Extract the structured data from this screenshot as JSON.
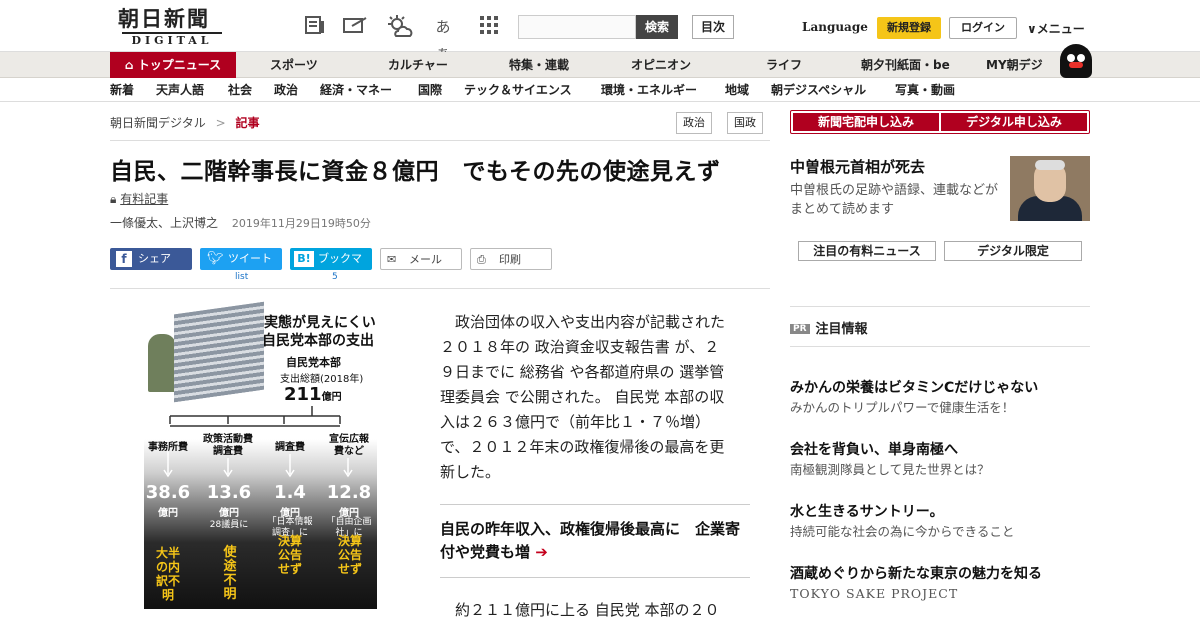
{
  "header": {
    "logo_jp": "朝日新聞",
    "logo_en": "DIGITAL",
    "search_button": "検索",
    "search_placeholder": "",
    "index_button": "目次",
    "language": "Language",
    "register": "新規登録",
    "login": "ログイン",
    "menu": "∨メニュー",
    "font_size_icon_text": "あぁ"
  },
  "nav_main": {
    "home": "トップニュース",
    "items": [
      "スポーツ",
      "カルチャー",
      "特集・連載",
      "オピニオン",
      "ライフ",
      "朝夕刊紙面・be",
      "MY朝デジ"
    ]
  },
  "nav_sub": {
    "items": [
      "新着",
      "天声人語",
      "社会",
      "政治",
      "経済・マネー",
      "国際",
      "テック＆サイエンス",
      "環境・エネルギー",
      "地域",
      "朝デジスペシャル",
      "写真・動画"
    ]
  },
  "breadcrumb": {
    "root": "朝日新聞デジタル",
    "sep": ">",
    "current": "記事"
  },
  "tags": [
    "政治",
    "国政"
  ],
  "article": {
    "title": "自民、二階幹事長に資金８億円　でもその先の使途見えず",
    "paid_label": "有料記事",
    "authors": "一條優太、上沢博之",
    "date": "2019年11月29日19時50分",
    "share": {
      "facebook": "シェア",
      "twitter": "ツイート",
      "hatena": "ブックマーク",
      "mail": "メール",
      "print": "印刷",
      "twitter_sub": "list",
      "hatena_sub": "5"
    },
    "para1_lines": [
      "　政治団体の収入や支出内容が記載された",
      "２０１８年の 政治資金収支報告書 が、２",
      "９日までに 総務省 や各都道府県の 選挙管",
      "理委員会 で公開された。 自民党 本部の収",
      "入は２６３億円で（前年比１・７％増）",
      "で、２０１２年末の政権復帰後の最高を更",
      "新した。"
    ],
    "related": "自民の昨年収入、政権復帰後最高に　企業寄付や党費も増",
    "para2_line": "　約２１１億円に上る 自民党 本部の２０"
  },
  "figure": {
    "heading1": "実態が見えにくい",
    "heading2": "自民党本部の支出",
    "sub1": "自民党本部",
    "sub2": "支出総額(2018年)",
    "total": "211",
    "total_unit": "億円",
    "categories": [
      {
        "label": "事務所費",
        "value": "38.6",
        "unit": "億円",
        "note": "",
        "verdict": "大半の内訳不明"
      },
      {
        "label": "政策活動費調査費",
        "value": "13.6",
        "unit": "億円",
        "note": "28議員に",
        "verdict": "使途不明"
      },
      {
        "label": "調査費",
        "value": "1.4",
        "unit": "億円",
        "note": "「日本情報調査」に",
        "verdict": "決算公告せず"
      },
      {
        "label": "宣伝広報費など",
        "value": "12.8",
        "unit": "億円",
        "note": "「自由企画社」に",
        "verdict": "決算公告せず"
      }
    ]
  },
  "sidebar": {
    "buttons": [
      "新聞宅配申し込み",
      "デジタル申し込み"
    ],
    "feature_title": "中曽根元首相が死去",
    "feature_sub": "中曽根氏の足跡や語録、連載などがまとめて読めます",
    "pills": [
      "注目の有料ニュース",
      "デジタル限定"
    ],
    "pr_badge": "PR",
    "pr_title": "注目情報",
    "ads": [
      {
        "h": "みかんの栄養はビタミンCだけじゃない",
        "s": "みかんのトリプルパワーで健康生活を！"
      },
      {
        "h": "会社を背負い、単身南極へ",
        "s": "南極観測隊員として見た世界とは？"
      },
      {
        "h": "水と生きるサントリー。",
        "s": "持続可能な社会の為に今からできること"
      },
      {
        "h": "酒蔵めぐりから新たな東京の魅力を知る",
        "s": "TOKYO SAKE PROJECT"
      }
    ]
  },
  "colors": {
    "brand_red": "#b0001f",
    "register_yellow": "#f5c518",
    "facebook": "#3b5998",
    "twitter": "#1da1f2",
    "hatena": "#00a4de"
  }
}
